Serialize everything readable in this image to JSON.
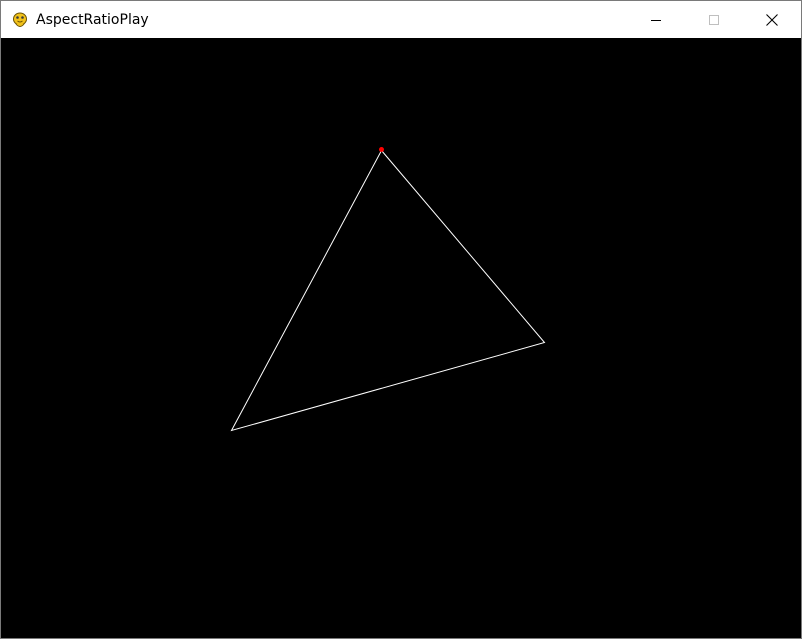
{
  "window": {
    "title": "AspectRatioPlay",
    "icon": "pygame-snake-icon",
    "controls": {
      "minimize": "minimize-icon",
      "maximize": "maximize-icon",
      "close": "close-icon"
    }
  },
  "canvas": {
    "background": "#000000",
    "triangle": {
      "stroke": "#ffffff",
      "vertex_highlight": "#ff0000"
    }
  }
}
